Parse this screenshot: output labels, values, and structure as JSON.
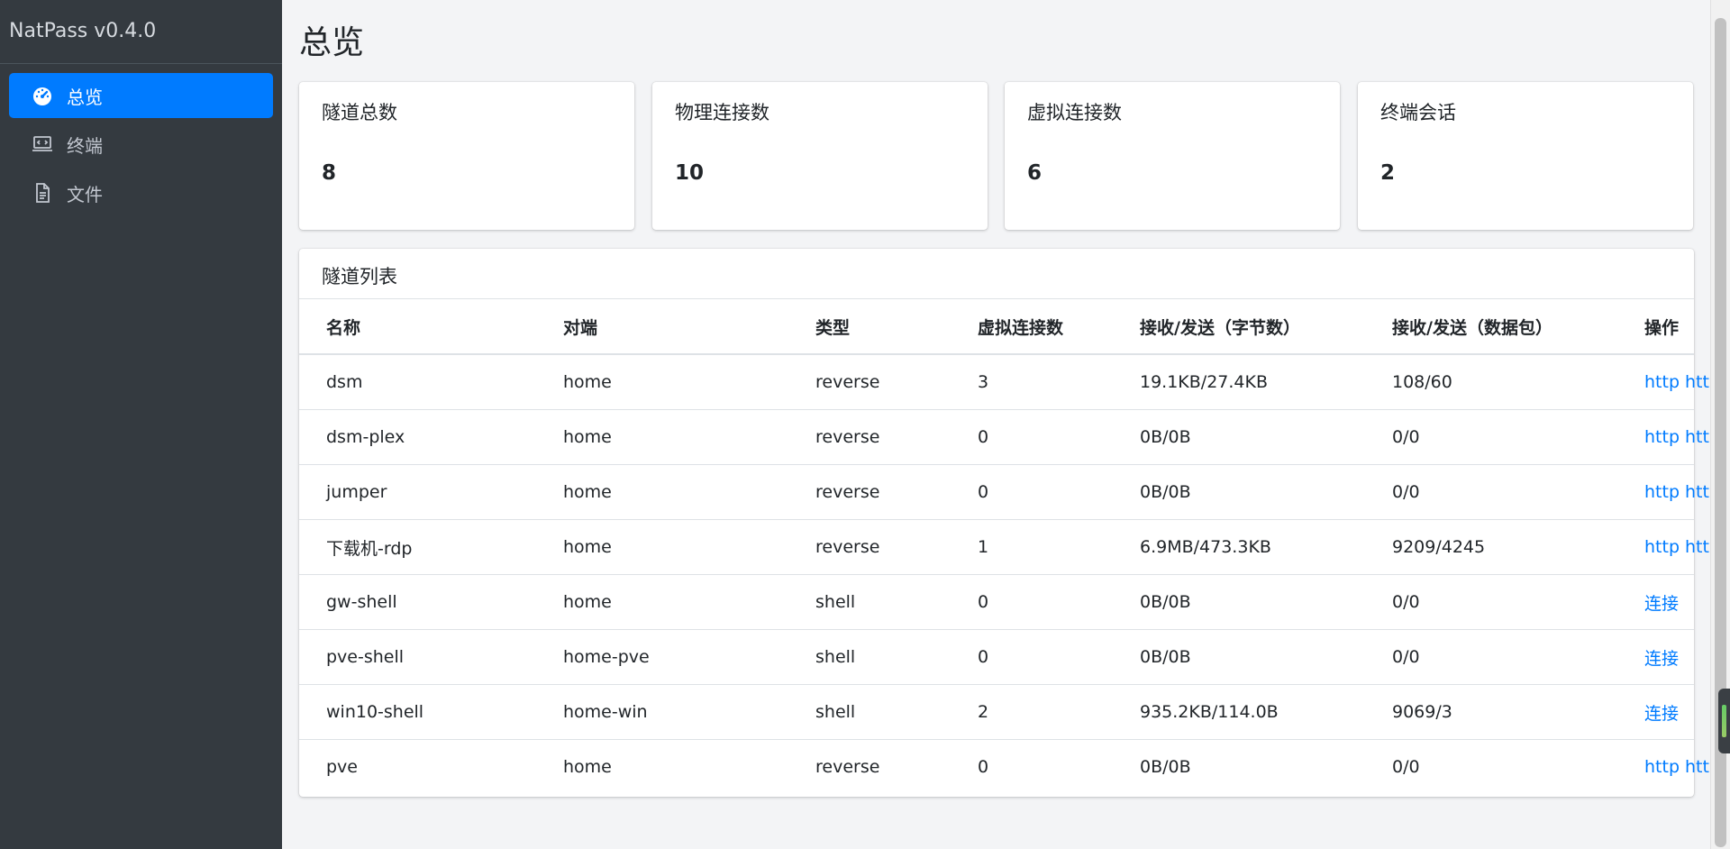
{
  "sidebar": {
    "brand": "NatPass v0.4.0",
    "items": [
      {
        "label": "总览",
        "icon": "dashboard-gauge-icon",
        "active": true
      },
      {
        "label": "终端",
        "icon": "terminal-laptop-icon",
        "active": false
      },
      {
        "label": "文件",
        "icon": "file-icon",
        "active": false
      }
    ]
  },
  "page": {
    "title": "总览"
  },
  "stats": [
    {
      "label": "隧道总数",
      "value": "8"
    },
    {
      "label": "物理连接数",
      "value": "10"
    },
    {
      "label": "虚拟连接数",
      "value": "6"
    },
    {
      "label": "终端会话",
      "value": "2"
    }
  ],
  "tunnels": {
    "title": "隧道列表",
    "headers": [
      "名称",
      "对端",
      "类型",
      "虚拟连接数",
      "接收/发送（字节数）",
      "接收/发送（数据包）",
      "操作"
    ],
    "rows": [
      {
        "name": "dsm",
        "peer": "home",
        "type": "reverse",
        "vconn": "3",
        "bytes": "19.1KB/27.4KB",
        "packets": "108/60",
        "actions": [
          "http",
          "https"
        ]
      },
      {
        "name": "dsm-plex",
        "peer": "home",
        "type": "reverse",
        "vconn": "0",
        "bytes": "0B/0B",
        "packets": "0/0",
        "actions": [
          "http",
          "https"
        ]
      },
      {
        "name": "jumper",
        "peer": "home",
        "type": "reverse",
        "vconn": "0",
        "bytes": "0B/0B",
        "packets": "0/0",
        "actions": [
          "http",
          "https"
        ]
      },
      {
        "name": "下载机-rdp",
        "peer": "home",
        "type": "reverse",
        "vconn": "1",
        "bytes": "6.9MB/473.3KB",
        "packets": "9209/4245",
        "actions": [
          "http",
          "https"
        ]
      },
      {
        "name": "gw-shell",
        "peer": "home",
        "type": "shell",
        "vconn": "0",
        "bytes": "0B/0B",
        "packets": "0/0",
        "actions": [
          "连接"
        ]
      },
      {
        "name": "pve-shell",
        "peer": "home-pve",
        "type": "shell",
        "vconn": "0",
        "bytes": "0B/0B",
        "packets": "0/0",
        "actions": [
          "连接"
        ]
      },
      {
        "name": "win10-shell",
        "peer": "home-win",
        "type": "shell",
        "vconn": "2",
        "bytes": "935.2KB/114.0B",
        "packets": "9069/3",
        "actions": [
          "连接"
        ]
      },
      {
        "name": "pve",
        "peer": "home",
        "type": "reverse",
        "vconn": "0",
        "bytes": "0B/0B",
        "packets": "0/0",
        "actions": [
          "http",
          "https"
        ]
      }
    ]
  },
  "colors": {
    "sidebar_bg": "#343a40",
    "active": "#007bff",
    "link": "#007bff",
    "page_bg": "#f3f4f6"
  }
}
